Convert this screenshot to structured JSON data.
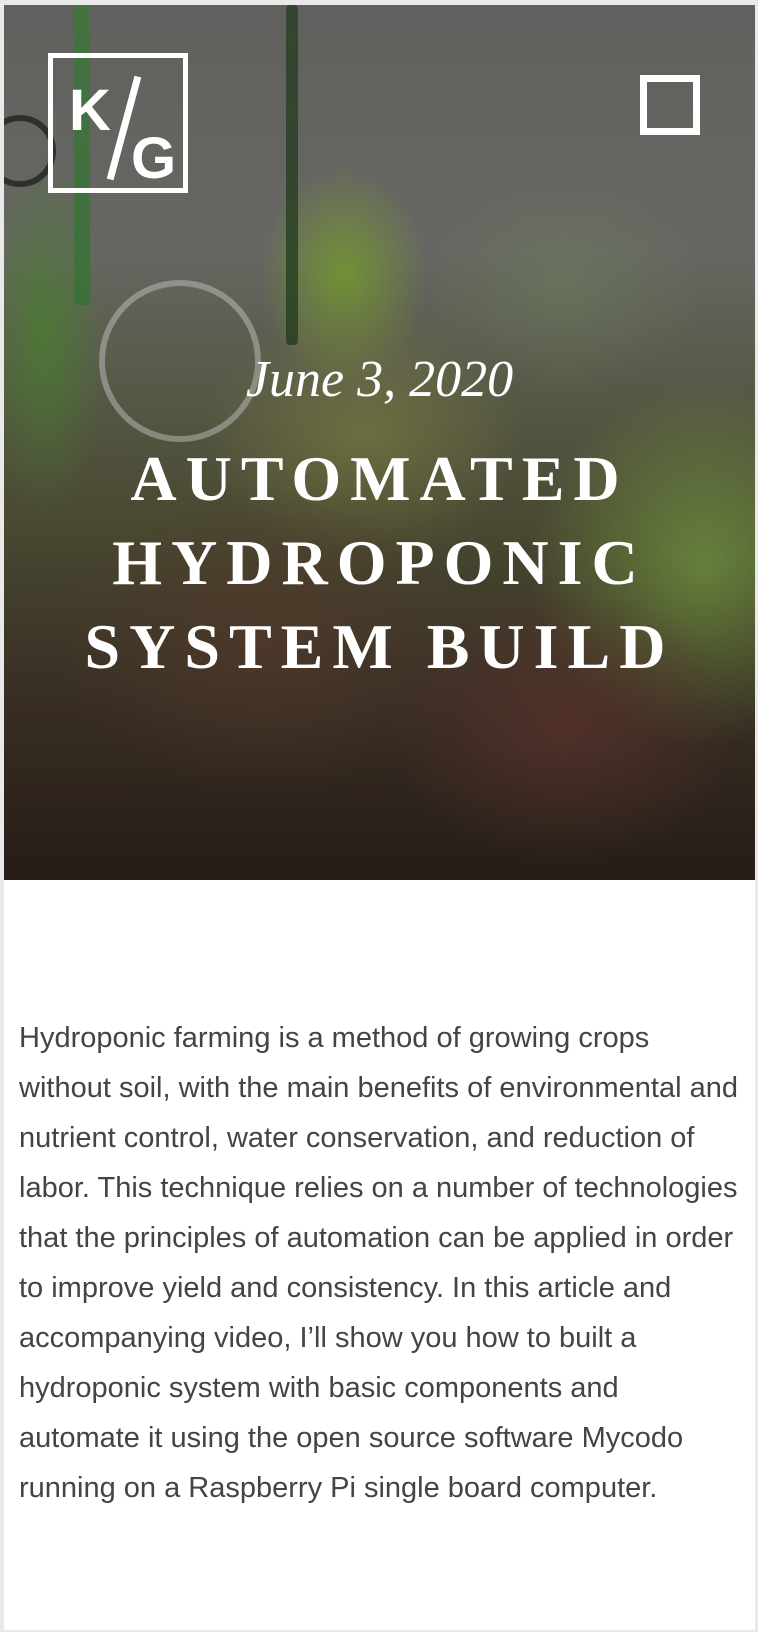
{
  "header": {
    "logo_text": "K/G",
    "menu_icon": "square-menu-icon"
  },
  "post": {
    "date": "June 3, 2020",
    "title": "AUTOMATED HYDROPONIC SYSTEM BUILD",
    "intro": "Hydroponic farming is a method of growing crops without soil, with the main benefits of environmental and nutrient control, water conservation, and reduction of labor. This technique relies on a number of technologies that the principles of automation can be applied in order to improve yield and consistency. In this article and accompanying video, I’ll show you how to built a hydroponic system with basic components and automate it using the open source software Mycodo running on a Raspberry Pi single board computer."
  },
  "colors": {
    "hero_text": "#ffffff",
    "body_text": "#444444",
    "page_background": "#ffffff"
  }
}
